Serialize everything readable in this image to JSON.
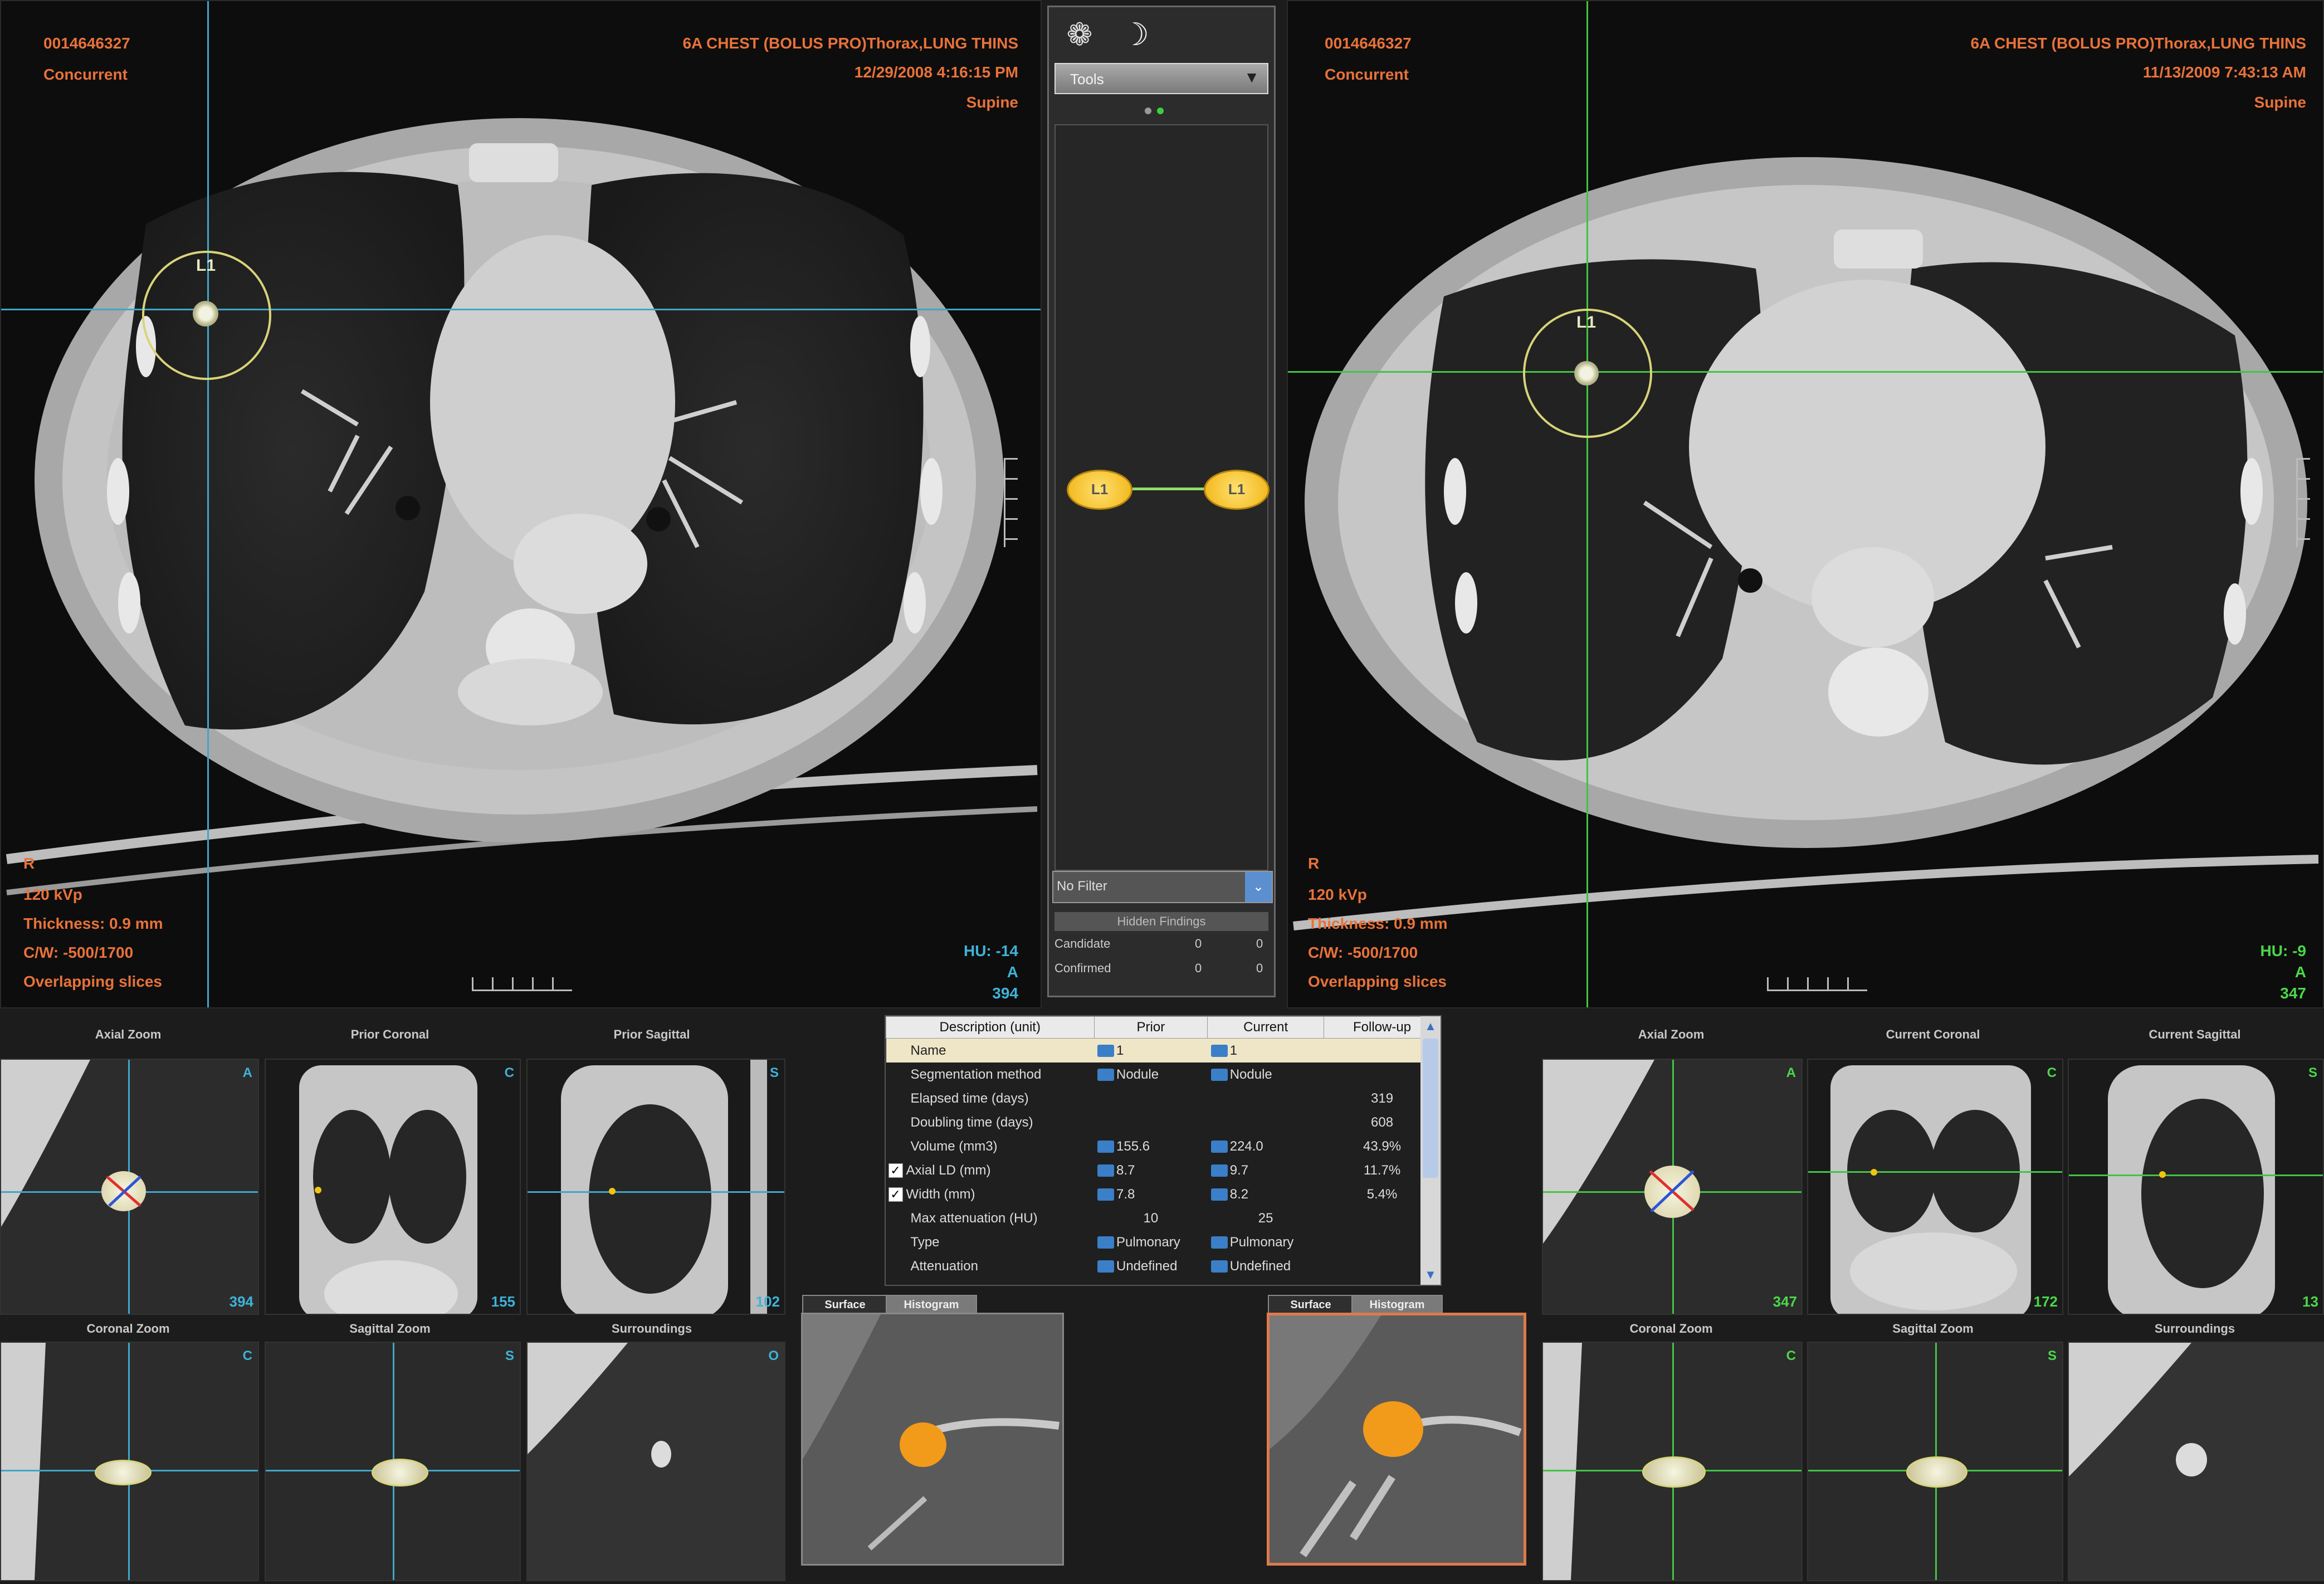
{
  "left_view": {
    "patient_id": "0014646327",
    "status": "Concurrent",
    "study": "6A CHEST (BOLUS PRO)Thorax,LUNG THINS",
    "datetime": "12/29/2008 4:16:15 PM",
    "position": "Supine",
    "orientation_letter": "R",
    "kvp": "120 kVp",
    "thickness": "Thickness: 0.9 mm",
    "cw": "C/W: -500/1700",
    "slices": "Overlapping slices",
    "hu": "HU: -14",
    "anterior": "A",
    "slice": "394",
    "lesion": "L1"
  },
  "right_view": {
    "patient_id": "0014646327",
    "status": "Concurrent",
    "study": "6A CHEST (BOLUS PRO)Thorax,LUNG THINS",
    "datetime": "11/13/2009 7:43:13 AM",
    "position": "Supine",
    "orientation_letter": "R",
    "kvp": "120 kVp",
    "thickness": "Thickness: 0.9 mm",
    "cw": "C/W: -500/1700",
    "slices": "Overlapping slices",
    "hu": "HU: -9",
    "anterior": "A",
    "slice": "347",
    "lesion": "L1"
  },
  "center_panel": {
    "tools_select": "Tools",
    "filter_select": "No Filter",
    "hidden_findings": "Hidden Findings",
    "candidate_label": "Candidate",
    "candidate_a": "0",
    "candidate_b": "0",
    "confirmed_label": "Confirmed",
    "confirmed_a": "0",
    "confirmed_b": "0",
    "node_a": "L1",
    "node_b": "L1"
  },
  "findings_table": {
    "headers": [
      "Description (unit)",
      "Prior",
      "Current",
      "Follow-up"
    ],
    "rows": [
      {
        "label": "Name",
        "prior": "1",
        "current": "1",
        "follow": ""
      },
      {
        "label": "Segmentation method",
        "prior": "Nodule",
        "current": "Nodule",
        "follow": ""
      },
      {
        "label": "Elapsed time (days)",
        "prior": "",
        "current": "",
        "follow": "319"
      },
      {
        "label": "Doubling time (days)",
        "prior": "",
        "current": "",
        "follow": "608"
      },
      {
        "label": "Volume (mm3)",
        "prior": "155.6",
        "current": "224.0",
        "follow": "43.9%"
      },
      {
        "label": "Axial LD (mm)",
        "prior": "8.7",
        "current": "9.7",
        "follow": "11.7%"
      },
      {
        "label": "Width (mm)",
        "prior": "7.8",
        "current": "8.2",
        "follow": "5.4%"
      },
      {
        "label": "Max attenuation (HU)",
        "prior": "10",
        "current": "25",
        "follow": ""
      },
      {
        "label": "Type",
        "prior": "Pulmonary",
        "current": "Pulmonary",
        "follow": ""
      },
      {
        "label": "Attenuation",
        "prior": "Undefined",
        "current": "Undefined",
        "follow": ""
      }
    ]
  },
  "prior_thumbs": {
    "axial_zoom": "Axial Zoom",
    "coronal": "Prior Coronal",
    "sagittal": "Prior Sagittal",
    "coronal_zoom": "Coronal Zoom",
    "sagittal_zoom": "Sagittal Zoom",
    "surroundings": "Surroundings",
    "axial_slice": "394",
    "coronal_slice": "155",
    "sagittal_slice": "102",
    "letter_a": "A",
    "letter_c": "C",
    "letter_s": "S",
    "letter_o": "O"
  },
  "current_thumbs": {
    "axial_zoom": "Axial Zoom",
    "coronal": "Current Coronal",
    "sagittal": "Current Sagittal",
    "coronal_zoom": "Coronal Zoom",
    "sagittal_zoom": "Sagittal Zoom",
    "surroundings": "Surroundings",
    "axial_slice": "347",
    "coronal_slice": "172",
    "sagittal_slice": "13",
    "letter_a": "A",
    "letter_c": "C",
    "letter_s": "S"
  },
  "render_tabs": {
    "surface": "Surface",
    "histogram": "Histogram"
  },
  "colors": {
    "overlay_text": "#e8723a",
    "prior_crosshair": "#3fa6c8",
    "current_crosshair": "#42c442",
    "lesion_ring": "#d8d47a",
    "nodule_3d": "#f29a1a"
  }
}
